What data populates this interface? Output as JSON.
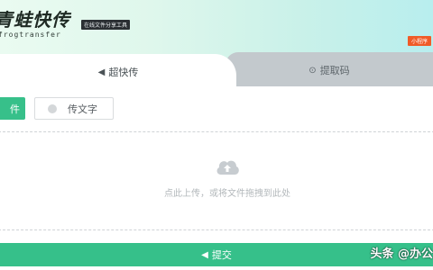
{
  "header": {
    "logo_title": "青蛙快传",
    "logo_sub": "frogtransfer",
    "tagline": "在线文件分享工具",
    "mini_badge": "小程序"
  },
  "tabs": [
    {
      "label": "超快传",
      "icon": "paper-plane-icon",
      "active": true
    },
    {
      "label": "提取码",
      "icon": "key-circle-icon",
      "active": false
    }
  ],
  "mode_buttons": {
    "file_label": "件",
    "text_label": "传文字"
  },
  "dropzone": {
    "icon": "cloud-upload-icon",
    "hint": "点此上传，或将文件拖拽到此处"
  },
  "submit": {
    "label": "提交",
    "icon": "paper-plane-icon"
  },
  "watermark": "头条 @办公",
  "colors": {
    "accent_green": "#37c08a",
    "badge_orange": "#f05b28",
    "inactive_tab": "#c3c9cd"
  }
}
